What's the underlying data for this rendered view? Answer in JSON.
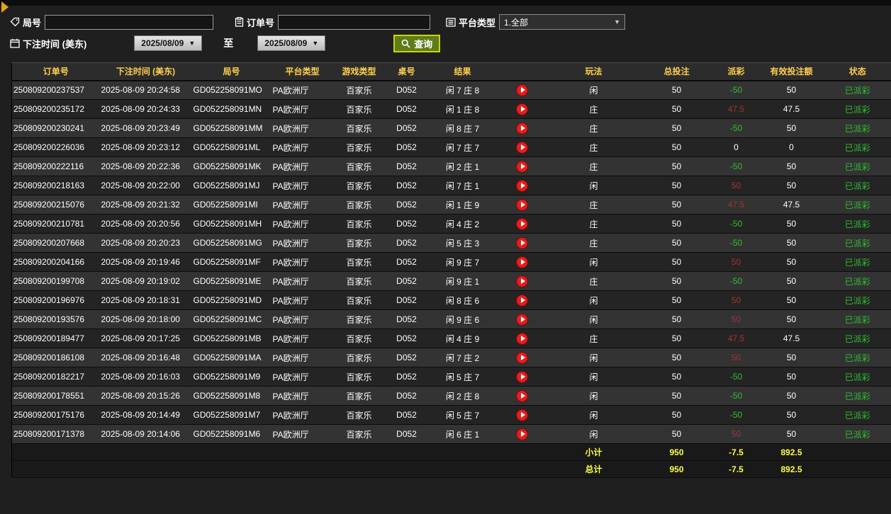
{
  "colors": {
    "accent_gold": "#e0a61c",
    "header_yellow": "#ffd04d",
    "footer_yellow": "#ffff4d",
    "loss_green": "#2fbf2f",
    "win_red": "#a33434",
    "status_green": "#2fbf2f",
    "query_btn_bg": "#5e7d18",
    "query_btn_border": "#c9d600",
    "play_red": "#e31e1e"
  },
  "filters": {
    "round_label": "局号",
    "round_value": "",
    "order_label": "订单号",
    "order_value": "",
    "platform_label": "平台类型",
    "platform_value": "1.全部",
    "bet_time_label": "下注时间 (美东)",
    "date_from": "2025/08/09",
    "to_label": "至",
    "date_to": "2025/08/09",
    "search_label": "查询"
  },
  "table": {
    "headers": [
      "订单号",
      "下注时间 (美东)",
      "局号",
      "平台类型",
      "游戏类型",
      "桌号",
      "结果",
      "",
      "玩法",
      "总投注",
      "派彩",
      "有效投注额",
      "状态"
    ],
    "rows": [
      [
        "250809200237537",
        "2025-08-09 20:24:58",
        "GD052258091MO",
        "PA欧洲厅",
        "百家乐",
        "D052",
        "闲 7 庄 8",
        "闲",
        "50",
        "-50",
        "50",
        "已派彩"
      ],
      [
        "250809200235172",
        "2025-08-09 20:24:33",
        "GD052258091MN",
        "PA欧洲厅",
        "百家乐",
        "D052",
        "闲 1 庄 8",
        "庄",
        "50",
        "47.5",
        "47.5",
        "已派彩"
      ],
      [
        "250809200230241",
        "2025-08-09 20:23:49",
        "GD052258091MM",
        "PA欧洲厅",
        "百家乐",
        "D052",
        "闲 8 庄 7",
        "庄",
        "50",
        "-50",
        "50",
        "已派彩"
      ],
      [
        "250809200226036",
        "2025-08-09 20:23:12",
        "GD052258091ML",
        "PA欧洲厅",
        "百家乐",
        "D052",
        "闲 7 庄 7",
        "庄",
        "50",
        "0",
        "0",
        "已派彩"
      ],
      [
        "250809200222116",
        "2025-08-09 20:22:36",
        "GD052258091MK",
        "PA欧洲厅",
        "百家乐",
        "D052",
        "闲 2 庄 1",
        "庄",
        "50",
        "-50",
        "50",
        "已派彩"
      ],
      [
        "250809200218163",
        "2025-08-09 20:22:00",
        "GD052258091MJ",
        "PA欧洲厅",
        "百家乐",
        "D052",
        "闲 7 庄 1",
        "闲",
        "50",
        "50",
        "50",
        "已派彩"
      ],
      [
        "250809200215076",
        "2025-08-09 20:21:32",
        "GD052258091MI",
        "PA欧洲厅",
        "百家乐",
        "D052",
        "闲 1 庄 9",
        "庄",
        "50",
        "47.5",
        "47.5",
        "已派彩"
      ],
      [
        "250809200210781",
        "2025-08-09 20:20:56",
        "GD052258091MH",
        "PA欧洲厅",
        "百家乐",
        "D052",
        "闲 4 庄 2",
        "庄",
        "50",
        "-50",
        "50",
        "已派彩"
      ],
      [
        "250809200207668",
        "2025-08-09 20:20:23",
        "GD052258091MG",
        "PA欧洲厅",
        "百家乐",
        "D052",
        "闲 5 庄 3",
        "庄",
        "50",
        "-50",
        "50",
        "已派彩"
      ],
      [
        "250809200204166",
        "2025-08-09 20:19:46",
        "GD052258091MF",
        "PA欧洲厅",
        "百家乐",
        "D052",
        "闲 9 庄 7",
        "闲",
        "50",
        "50",
        "50",
        "已派彩"
      ],
      [
        "250809200199708",
        "2025-08-09 20:19:02",
        "GD052258091ME",
        "PA欧洲厅",
        "百家乐",
        "D052",
        "闲 9 庄 1",
        "庄",
        "50",
        "-50",
        "50",
        "已派彩"
      ],
      [
        "250809200196976",
        "2025-08-09 20:18:31",
        "GD052258091MD",
        "PA欧洲厅",
        "百家乐",
        "D052",
        "闲 8 庄 6",
        "闲",
        "50",
        "50",
        "50",
        "已派彩"
      ],
      [
        "250809200193576",
        "2025-08-09 20:18:00",
        "GD052258091MC",
        "PA欧洲厅",
        "百家乐",
        "D052",
        "闲 9 庄 6",
        "闲",
        "50",
        "50",
        "50",
        "已派彩"
      ],
      [
        "250809200189477",
        "2025-08-09 20:17:25",
        "GD052258091MB",
        "PA欧洲厅",
        "百家乐",
        "D052",
        "闲 4 庄 9",
        "庄",
        "50",
        "47.5",
        "47.5",
        "已派彩"
      ],
      [
        "250809200186108",
        "2025-08-09 20:16:48",
        "GD052258091MA",
        "PA欧洲厅",
        "百家乐",
        "D052",
        "闲 7 庄 2",
        "闲",
        "50",
        "50",
        "50",
        "已派彩"
      ],
      [
        "250809200182217",
        "2025-08-09 20:16:03",
        "GD052258091M9",
        "PA欧洲厅",
        "百家乐",
        "D052",
        "闲 5 庄 7",
        "闲",
        "50",
        "-50",
        "50",
        "已派彩"
      ],
      [
        "250809200178551",
        "2025-08-09 20:15:26",
        "GD052258091M8",
        "PA欧洲厅",
        "百家乐",
        "D052",
        "闲 2 庄 8",
        "闲",
        "50",
        "-50",
        "50",
        "已派彩"
      ],
      [
        "250809200175176",
        "2025-08-09 20:14:49",
        "GD052258091M7",
        "PA欧洲厅",
        "百家乐",
        "D052",
        "闲 5 庄 7",
        "闲",
        "50",
        "-50",
        "50",
        "已派彩"
      ],
      [
        "250809200171378",
        "2025-08-09 20:14:06",
        "GD052258091M6",
        "PA欧洲厅",
        "百家乐",
        "D052",
        "闲 6 庄 1",
        "闲",
        "50",
        "50",
        "50",
        "已派彩"
      ]
    ],
    "subtotal": {
      "label": "小计",
      "total_bet": "950",
      "payout": "-7.5",
      "valid_bet": "892.5"
    },
    "total": {
      "label": "总计",
      "total_bet": "950",
      "payout": "-7.5",
      "valid_bet": "892.5"
    }
  }
}
